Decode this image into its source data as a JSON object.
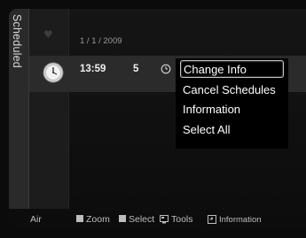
{
  "side_tab": {
    "label": "Scheduled"
  },
  "list": {
    "date": "1 / 1 / 2009",
    "rows": [
      {
        "time": "13:59",
        "channel": "5"
      }
    ]
  },
  "menu": {
    "items": [
      {
        "label": "Change Info",
        "selected": true
      },
      {
        "label": "Cancel Schedules"
      },
      {
        "label": "Information"
      },
      {
        "label": "Select All"
      }
    ]
  },
  "footer": {
    "source": "Air",
    "zoom": "Zoom",
    "select": "Select",
    "tools": "Tools",
    "information": "Information"
  },
  "icons": {
    "favorite": "heart-icon",
    "schedule": "clock-icon",
    "timer": "small-clock-icon",
    "tools": "tools-icon",
    "info": "info-icon",
    "key": "square-key-icon"
  }
}
